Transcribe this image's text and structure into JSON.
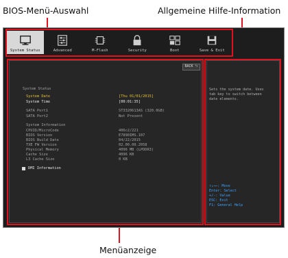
{
  "callouts": {
    "menu_select": "BIOS-Menü-Auswahl",
    "general_help": "Allgemeine Hilfe-Information",
    "menu_display": "Menüanzeige"
  },
  "menu": [
    {
      "label": "System Status",
      "icon": "monitor-icon"
    },
    {
      "label": "Advanced",
      "icon": "sliders-icon"
    },
    {
      "label": "M-Flash",
      "icon": "chip-icon"
    },
    {
      "label": "Security",
      "icon": "lock-icon"
    },
    {
      "label": "Boot",
      "icon": "boot-icon"
    },
    {
      "label": "Save & Exit",
      "icon": "floppy-icon"
    }
  ],
  "back_label": "BACK ⮌",
  "main": {
    "section_title": "System Status",
    "date_label": "System Date",
    "date_value": "[Thu 01/01/2015]",
    "time_label": "System Time",
    "time_value": "[00:01:35]",
    "sata1_label": "SATA Port1",
    "sata1_value": "ST3320613AS       (320.0GB)",
    "sata2_label": "SATA Port2",
    "sata2_value": "Not Present",
    "info_title": "System Information",
    "info": [
      {
        "label": "CPUID/MicroCode",
        "value": "406c2/221"
      },
      {
        "label": "BIOS Version",
        "value": "E7890IMS.107"
      },
      {
        "label": "BIOS Build Date",
        "value": "04/22/2015"
      },
      {
        "label": "TXE FW Version",
        "value": "02.00.00.2058"
      },
      {
        "label": "Physical Memory",
        "value": "4096 MB (LPDDR3)"
      },
      {
        "label": "Cache Size",
        "value": "4096 KB"
      },
      {
        "label": "L3 Cache Size",
        "value": "0 KB"
      }
    ],
    "dmi_label": "DMI Information"
  },
  "help": {
    "text_lines": [
      "Sets the system date.  Uses",
      "tab key to switch between",
      "date elements."
    ],
    "keys": [
      "↑↓→←: Move",
      "Enter: Select",
      "+/-: Value",
      "ESC: Exit",
      "F1: General Help"
    ]
  },
  "colors": {
    "accent_red": "#e0121d",
    "highlight_yellow": "#e6c23a",
    "key_blue": "#3fa4ff",
    "bios_bg": "#1d1d1d"
  }
}
